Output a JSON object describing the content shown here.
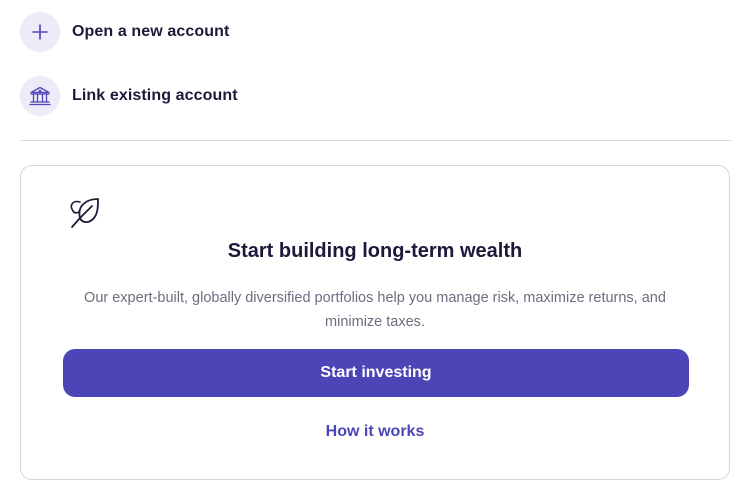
{
  "actions": {
    "open_label": "Open a new account",
    "open_icon": "plus-icon",
    "link_label": "Link existing account",
    "link_icon": "bank-icon"
  },
  "card": {
    "icon": "leaf-icon",
    "title": "Start building long-term wealth",
    "body": "Our expert-built, globally diversified portfolios help you manage risk, maximize returns, and minimize taxes.",
    "primary_button": "Start investing",
    "secondary_link": "How it works"
  },
  "colors": {
    "accent": "#4b45b8",
    "icon_bg": "#ecebf7",
    "text": "#1b1a3a",
    "muted_text": "#6e6d80",
    "border": "#d6d6de"
  }
}
